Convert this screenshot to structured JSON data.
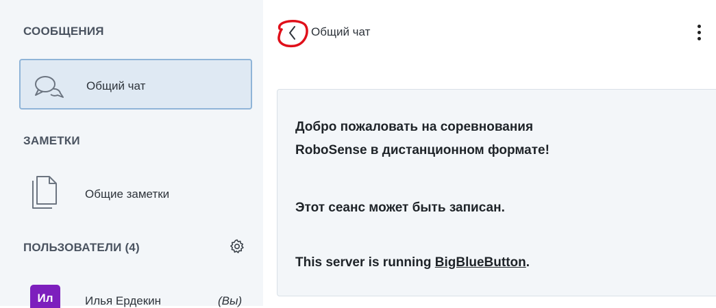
{
  "sidebar": {
    "messages_title": "СООБЩЕНИЯ",
    "public_chat_label": "Общий чат",
    "notes_title": "ЗАМЕТКИ",
    "shared_notes_label": "Общие заметки",
    "users_title": "ПОЛЬЗОВАТЕЛИ (4)",
    "users": [
      {
        "initials": "Ил",
        "name": "Илья Ердекин",
        "you_badge": "(Вы)"
      }
    ]
  },
  "chat": {
    "title": "Общий чат",
    "welcome": {
      "line1": "Добро пожаловать на соревнования",
      "line2": "RoboSense в дистанционном формате!",
      "line3": "Этот сеанс может быть записан.",
      "line4_prefix": "This server is running",
      "line4_link": "BigBlueButton",
      "line4_suffix": "."
    }
  },
  "icons": {
    "chat": "chat-bubbles-icon",
    "notes": "document-pages-icon",
    "settings": "gear-icon",
    "back": "chevron-left-icon",
    "menu": "more-vertical-icon"
  },
  "colors": {
    "sidebar_bg": "#f3f6f9",
    "selected_bg": "#dfe9f3",
    "selected_border": "#8fb4d8",
    "avatar_bg": "#7d1fbd",
    "annotation_red": "#e0101a"
  }
}
